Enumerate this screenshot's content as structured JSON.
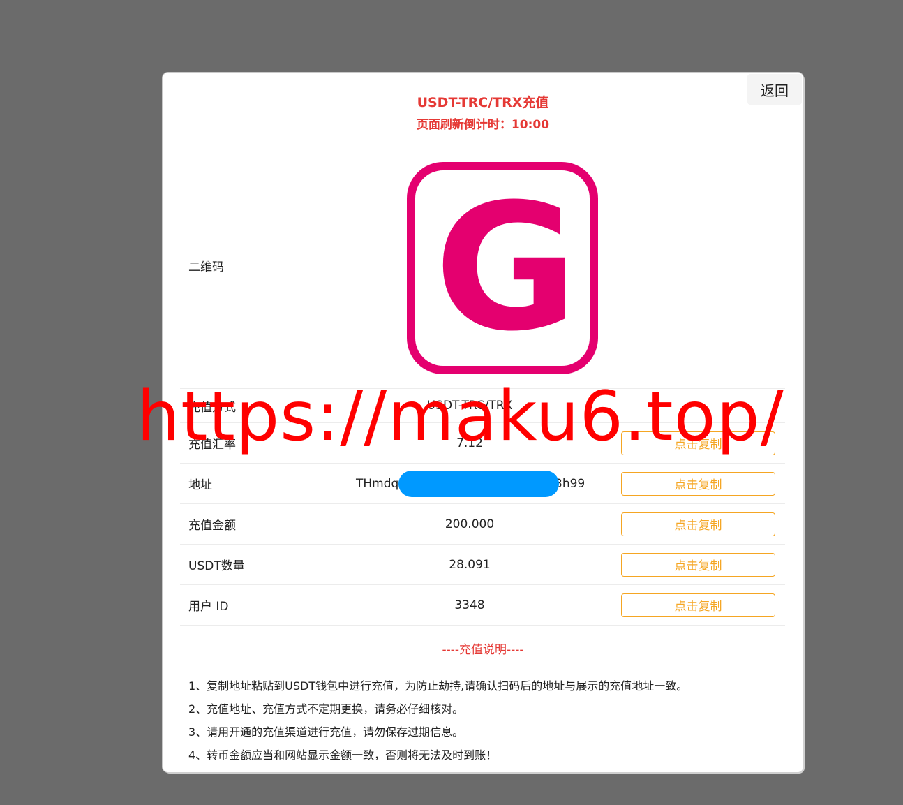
{
  "header": {
    "back_label": "返回",
    "title": "USDT-TRC/TRX充值",
    "countdown": "页面刷新倒计时：10:00"
  },
  "qr": {
    "label": "二维码",
    "logo_letter": "G",
    "logo_color": "#e4006f"
  },
  "rows": [
    {
      "label": "充值方式",
      "value": "USDT-TRC/TRX",
      "copy": ""
    },
    {
      "label": "充值汇率",
      "value": "7.12",
      "copy": "点击复制"
    },
    {
      "label": "地址",
      "value": "THmdq",
      "value_tail": "3h99",
      "copy": "点击复制"
    },
    {
      "label": "充值金额",
      "value": "200.000",
      "copy": "点击复制"
    },
    {
      "label": "USDT数量",
      "value": "28.091",
      "copy": "点击复制"
    },
    {
      "label": "用户 ID",
      "value": "3348",
      "copy": "点击复制"
    }
  ],
  "notes": {
    "heading": "----充值说明----",
    "items": [
      "1、复制地址粘贴到USDT钱包中进行充值，为防止劫持,请确认扫码后的地址与展示的充值地址一致。",
      "2、充值地址、充值方式不定期更换，请务必仔细核对。",
      "3、请用开通的充值渠道进行充值，请勿保存过期信息。",
      "4、转币金额应当和网站显示金额一致，否则将无法及时到账！"
    ]
  },
  "watermark": "https://maku6.top/",
  "colors": {
    "accent_red": "#e53935",
    "button_orange": "#f5a623",
    "redact_blue": "#0099ff"
  }
}
